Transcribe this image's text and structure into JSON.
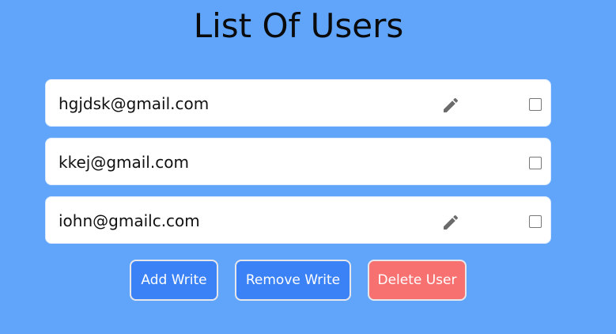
{
  "page": {
    "title": "List Of Users"
  },
  "users": [
    {
      "email": "hgjdsk@gmail.com",
      "editable": true,
      "checked": false
    },
    {
      "email": "kkej@gmail.com",
      "editable": false,
      "checked": false
    },
    {
      "email": "iohn@gmailc.com",
      "editable": true,
      "checked": false
    }
  ],
  "icons": {
    "edit": "pencil-icon",
    "select": "checkbox"
  },
  "actions": {
    "add_write": "Add Write",
    "remove_write": "Remove Write",
    "delete_user": "Delete User"
  },
  "colors": {
    "background": "#60a5fa",
    "primary_button": "#3b82f6",
    "danger_button": "#f87171",
    "icon": "#6b6b6b"
  }
}
